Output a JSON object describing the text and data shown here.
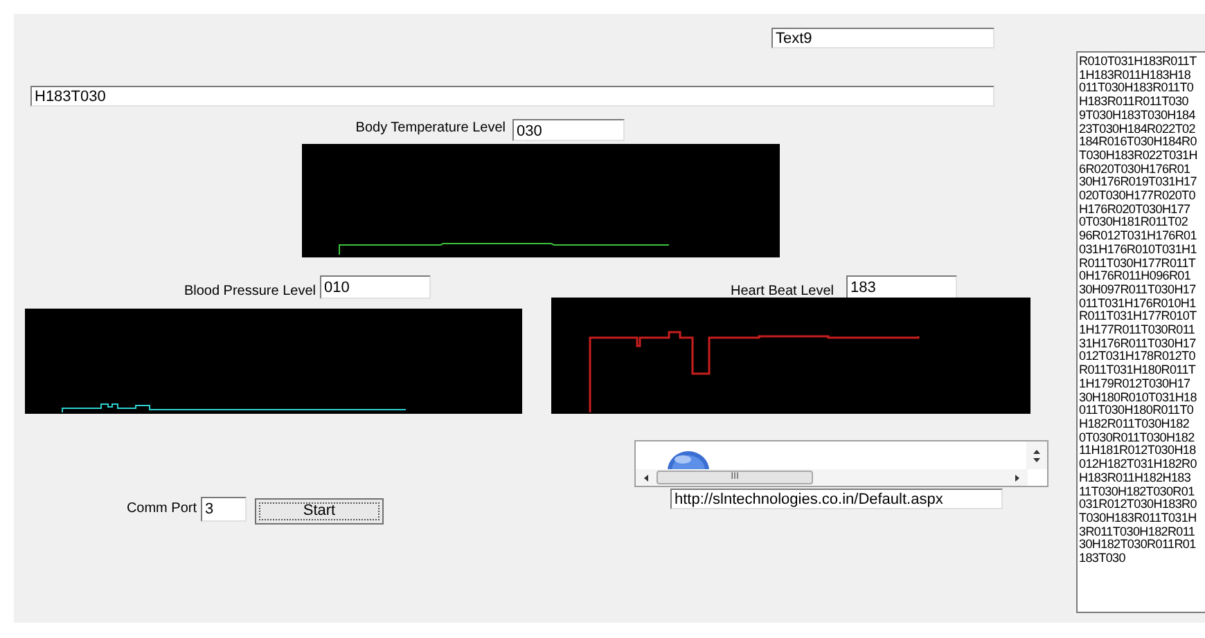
{
  "text9_field": {
    "value": "Text9"
  },
  "received_field": {
    "value": "H183T030"
  },
  "body_temperature": {
    "label": "Body Temperature Level",
    "value": "030"
  },
  "blood_pressure": {
    "label": "Blood Pressure Level",
    "value": "010"
  },
  "heart_beat": {
    "label": "Heart Beat Level",
    "value": "183"
  },
  "browser": {
    "scroll_grip": "III",
    "url": "http://slntechnologies.co.in/Default.aspx"
  },
  "comm_port": {
    "label": "Comm Port",
    "value": "3"
  },
  "start_button": {
    "label": "Start"
  },
  "log_lines": [
    "R010T031H183R011T",
    "1H183R011H183H18",
    "011T030H183R011T0",
    "H183R011R011T030",
    "9T030H183T030H184",
    "23T030H184R022T02",
    "184R016T030H184R0",
    "T030H183R022T031H",
    "6R020T030H176R01",
    "30H176R019T031H17",
    "020T030H177R020T0",
    "H176R020T030H177",
    "0T030H181R011T02",
    "96R012T031H176R01",
    "031H176R010T031H1",
    "R011T030H177R011T",
    "0H176R011H096R01",
    "30H097R011T030H17",
    "011T031H176R010H1",
    "R011T031H177R010T",
    "1H177R011T030R011",
    "31H176R011T030H17",
    "012T031H178R012T0",
    "R011T031H180R011T",
    "1H179R012T030H17",
    "30H180R010T031H18",
    "011T030H180R011T0",
    "H182R011T030H182",
    "0T030R011T030H182",
    "11H181R012T030H18",
    "012H182T031H182R0",
    "H183R011H182H183",
    "11T030H182T030R01",
    "031R012T030H183R0",
    "T030H183R011T031H",
    "3R011T030H182R011",
    "30H182T030R011R01",
    "183T030"
  ]
}
